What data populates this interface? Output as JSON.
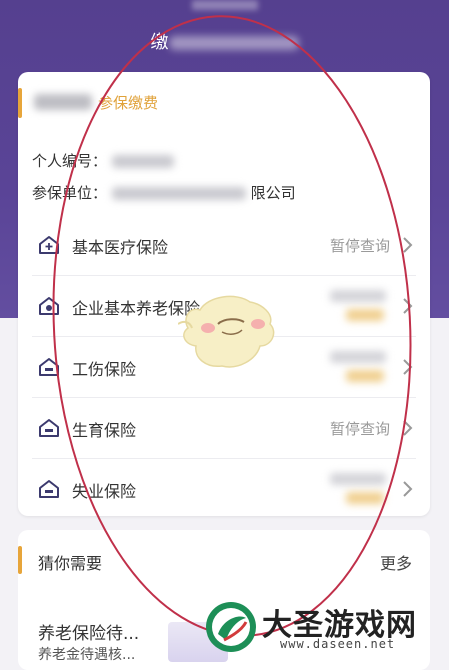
{
  "header": {
    "title_visible": "缴"
  },
  "account_card": {
    "tag": "参保缴费",
    "personal_id_label": "个人编号：",
    "employer_label": "参保单位：",
    "employer_suffix": "限公司"
  },
  "insurance_items": [
    {
      "label": "基本医疗保险",
      "status": "暂停查询",
      "icon": "hospital-house-icon"
    },
    {
      "label": "企业基本养老保险",
      "status": "",
      "icon": "pension-house-icon"
    },
    {
      "label": "工伤保险",
      "status": "",
      "icon": "injury-house-icon"
    },
    {
      "label": "生育保险",
      "status": "暂停查询",
      "icon": "maternity-house-icon"
    },
    {
      "label": "失业保险",
      "status": "",
      "icon": "unemployment-house-icon"
    }
  ],
  "needs": {
    "title": "猜你需要",
    "more": "更多",
    "item_title": "养老保险待...",
    "item_subtitle": "养老金待遇核..."
  },
  "watermark": {
    "text": "大圣游戏网",
    "url": "www.daseen.net"
  },
  "colors": {
    "header_purple": "#55408f",
    "accent_orange": "#e7a53a",
    "annotation_red": "#c0304a"
  }
}
